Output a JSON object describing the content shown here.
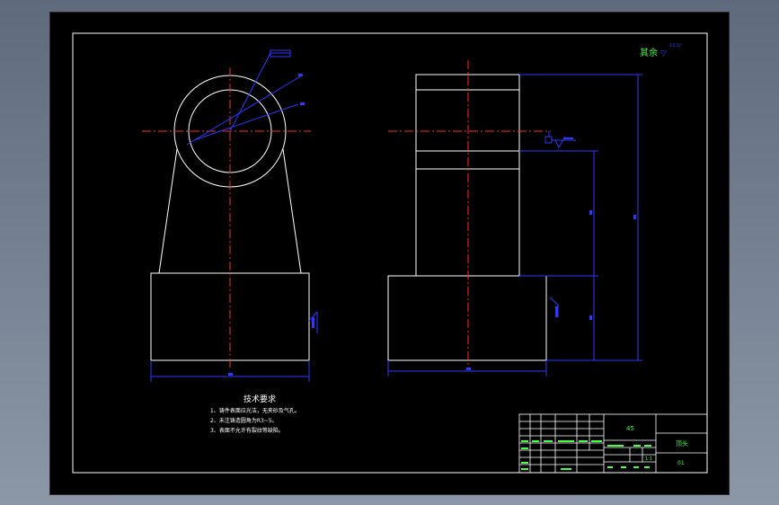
{
  "drawing": {
    "finish_note": {
      "label": "其余",
      "symbol": "▽",
      "value": "12.5/"
    },
    "tech_req": {
      "title": "技术要求",
      "lines": [
        "1、铸件表面应光洁，无夹砂及气孔。",
        "2、未注铸造圆角为R3~5。",
        "3、表面不允许有裂纹等缺陷。"
      ]
    },
    "title_block": {
      "material": "45",
      "part_name": "顶头",
      "scale": "1:1",
      "drawing_no": "01"
    },
    "colors": {
      "outline": "#ffffff",
      "center": "#ff2a2a",
      "dim": "#2d37ff",
      "text": "#43ff43",
      "frame": "#ffffff"
    }
  }
}
